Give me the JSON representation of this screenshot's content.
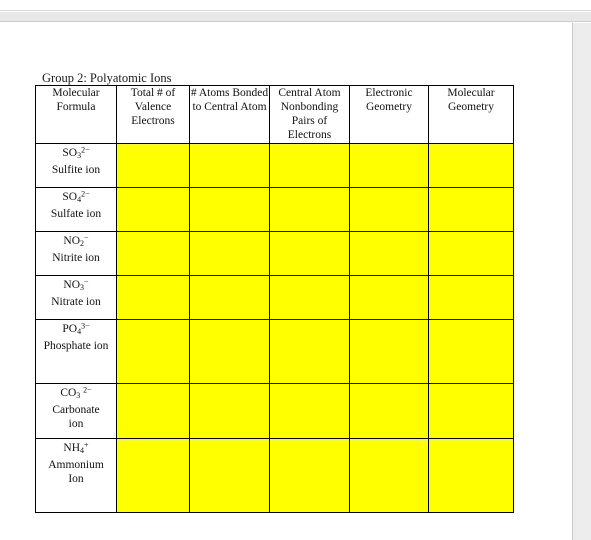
{
  "page": {
    "caption": "Group 2: Polyatomic Ions"
  },
  "table": {
    "columns": [
      "Molecular Formula",
      "Total # of Valence Electrons",
      "# Atoms Bonded to Central Atom",
      "Central Atom Nonbonding Pairs of Electrons",
      "Electronic Geometry",
      "Molecular Geometry"
    ],
    "answer_cell_color": "#FFFF00",
    "rows": [
      {
        "formula_plain": "SO3^2-",
        "name": "Sulfite ion",
        "answers": [
          "",
          "",
          "",
          "",
          ""
        ]
      },
      {
        "formula_plain": "SO4^2-",
        "name": "Sulfate ion",
        "answers": [
          "",
          "",
          "",
          "",
          ""
        ]
      },
      {
        "formula_plain": "NO2^-",
        "name": "Nitrite ion",
        "answers": [
          "",
          "",
          "",
          "",
          ""
        ]
      },
      {
        "formula_plain": "NO3^-",
        "name": "Nitrate ion",
        "answers": [
          "",
          "",
          "",
          "",
          ""
        ]
      },
      {
        "formula_plain": "PO4^3-",
        "name": "Phosphate ion",
        "answers": [
          "",
          "",
          "",
          "",
          ""
        ]
      },
      {
        "formula_plain": "CO3^2-",
        "name": "Carbonate ion",
        "answers": [
          "",
          "",
          "",
          "",
          ""
        ]
      },
      {
        "formula_plain": "NH4^+",
        "name": "Ammonium Ion",
        "answers": [
          "",
          "",
          "",
          "",
          ""
        ]
      }
    ]
  }
}
